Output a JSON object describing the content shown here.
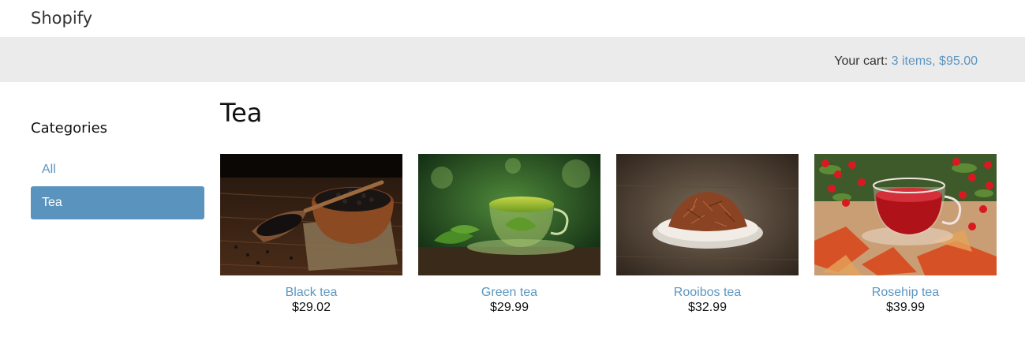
{
  "header": {
    "brand": "Shopify"
  },
  "cart": {
    "label": "Your cart:",
    "summary": "3 items, $95.00"
  },
  "sidebar": {
    "title": "Categories",
    "items": [
      {
        "label": "All",
        "active": false
      },
      {
        "label": "Tea",
        "active": true
      }
    ]
  },
  "main": {
    "title": "Tea",
    "products": [
      {
        "name": "Black tea",
        "price": "$29.02",
        "image": "black-tea-bowl-image"
      },
      {
        "name": "Green tea",
        "price": "$29.99",
        "image": "green-tea-cup-image"
      },
      {
        "name": "Rooibos tea",
        "price": "$32.99",
        "image": "rooibos-tea-dish-image"
      },
      {
        "name": "Rosehip tea",
        "price": "$39.99",
        "image": "rosehip-tea-cup-image"
      }
    ]
  },
  "colors": {
    "link": "#5b96c0",
    "active_bg": "#5a94be",
    "cartbar_bg": "#ebebeb"
  }
}
